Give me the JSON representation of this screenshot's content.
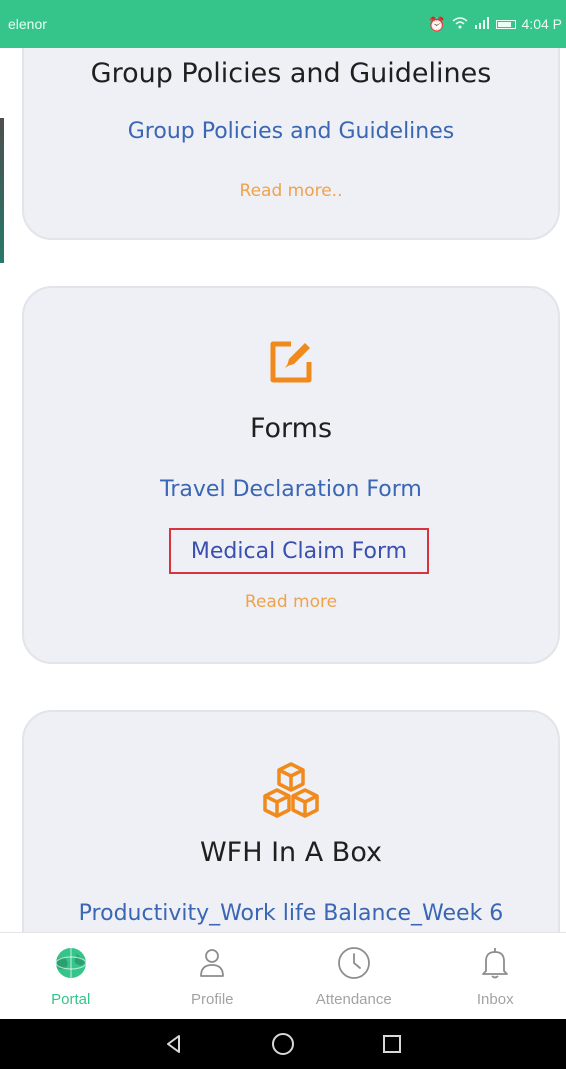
{
  "status_bar": {
    "carrier": "elenor",
    "time": "4:04 P"
  },
  "cards": [
    {
      "title": "Group Policies and Guidelines",
      "link": "Group Policies and Guidelines",
      "read_more": "Read more.."
    },
    {
      "icon": "edit-form-icon",
      "title": "Forms",
      "links": [
        "Travel Declaration Form",
        "Medical Claim Form"
      ],
      "read_more": "Read more"
    },
    {
      "icon": "boxes-icon",
      "title": "WFH In A Box",
      "link": "Productivity_Work life Balance_Week 6"
    }
  ],
  "bottom_nav": [
    {
      "label": "Portal",
      "icon": "globe-icon",
      "active": true
    },
    {
      "label": "Profile",
      "icon": "user-icon",
      "active": false
    },
    {
      "label": "Attendance",
      "icon": "clock-icon",
      "active": false
    },
    {
      "label": "Inbox",
      "icon": "bell-icon",
      "active": false
    }
  ],
  "colors": {
    "accent": "#35c48a",
    "link": "#3a66b3",
    "read_more": "#f0a24a",
    "icon_orange": "#f08a1c",
    "highlight": "#d8343f",
    "card_bg": "#eef0f5"
  }
}
